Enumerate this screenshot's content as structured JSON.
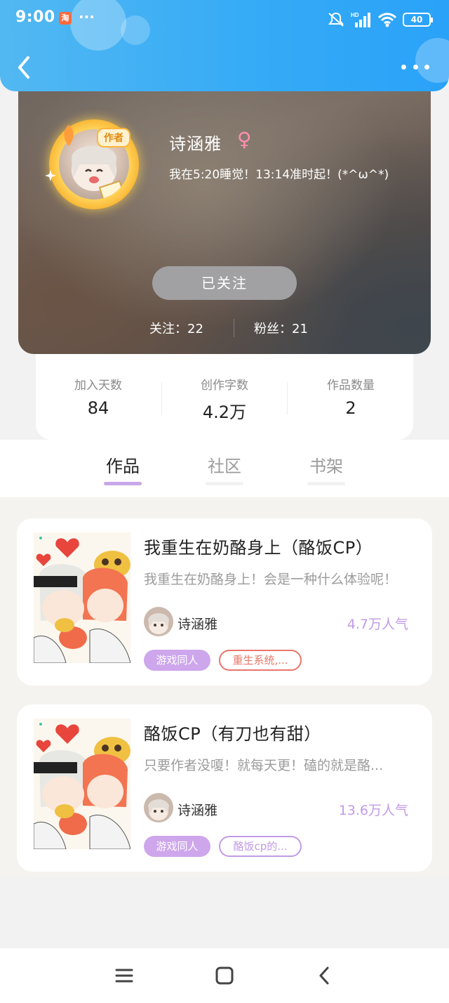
{
  "status_bar": {
    "time": "9:00",
    "dots": "···",
    "network_label": "HD",
    "battery": "40"
  },
  "profile": {
    "author_tag": "作者",
    "name": "诗涵雅",
    "gender_symbol": "♀",
    "bio": "我在5:20睡觉！13:14准时起！(*^ω^*)",
    "follow_button": "已关注",
    "following": "关注：22",
    "fans": "粉丝：21"
  },
  "counters": [
    {
      "label": "加入天数",
      "value": "84"
    },
    {
      "label": "创作字数",
      "value": "4.2万"
    },
    {
      "label": "作品数量",
      "value": "2"
    }
  ],
  "tabs": [
    {
      "label": "作品",
      "active": true
    },
    {
      "label": "社区",
      "active": false
    },
    {
      "label": "书架",
      "active": false
    }
  ],
  "books": [
    {
      "title": "我重生在奶酪身上（酪饭CP）",
      "description": "我重生在奶酪身上！会是一种什么体验呢！",
      "author": "诗涵雅",
      "popularity": "4.7万人气",
      "tag_primary": "游戏同人",
      "tag_secondary": "重生系统,...",
      "tag_secondary_color": "#e9766a"
    },
    {
      "title": "酪饭CP（有刀也有甜）",
      "description": "只要作者没嗄！就每天更！磕的就是酪...",
      "author": "诗涵雅",
      "popularity": "13.6万人气",
      "tag_primary": "游戏同人",
      "tag_secondary": "酪饭cp的...",
      "tag_secondary_color": "#c29be6"
    }
  ],
  "colors": {
    "header_gradient_start": "#52b8f2",
    "header_gradient_end": "#2aa2f8",
    "accent_purple": "#c29be6",
    "tag_purple": "#cda6ec"
  }
}
